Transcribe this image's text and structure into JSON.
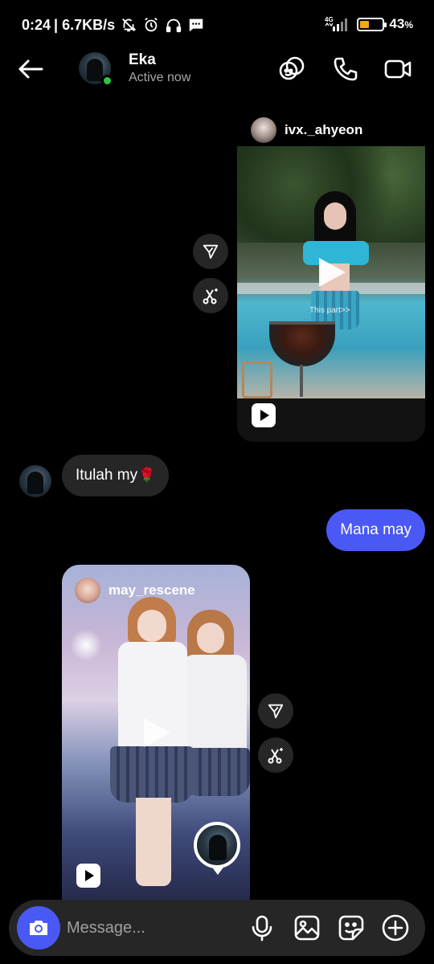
{
  "status_bar": {
    "time": "0:24",
    "speed": "| 6.7KB/s",
    "network": "4G",
    "battery": "43",
    "battery_unit": "%",
    "battery_level": 0.43,
    "icons": [
      "mute-bell-icon",
      "alarm-icon",
      "headphones-icon",
      "message-icon",
      "signal-icon",
      "battery-icon"
    ]
  },
  "header": {
    "contact_name": "Eka",
    "contact_status": "Active now",
    "icons": [
      "back-arrow-icon",
      "effects-icon",
      "phone-icon",
      "video-icon"
    ]
  },
  "messages": {
    "shared_post_1": {
      "username": "ivx._ahyeon",
      "overlay_text": "This part>>"
    },
    "incoming_1": {
      "text": "Itulah my",
      "emoji": "🌹"
    },
    "outgoing_1": {
      "text": "Mana may"
    },
    "shared_post_2": {
      "username": "may_rescene"
    }
  },
  "composer": {
    "placeholder": "Message...",
    "icons": [
      "camera-icon",
      "microphone-icon",
      "gallery-icon",
      "sticker-icon",
      "plus-circle-icon"
    ]
  },
  "colors": {
    "accent": "#4a58f6",
    "online": "#2ec64a",
    "bubble_in": "#262626",
    "background": "#000000",
    "battery_fill": "#f0a81c"
  }
}
